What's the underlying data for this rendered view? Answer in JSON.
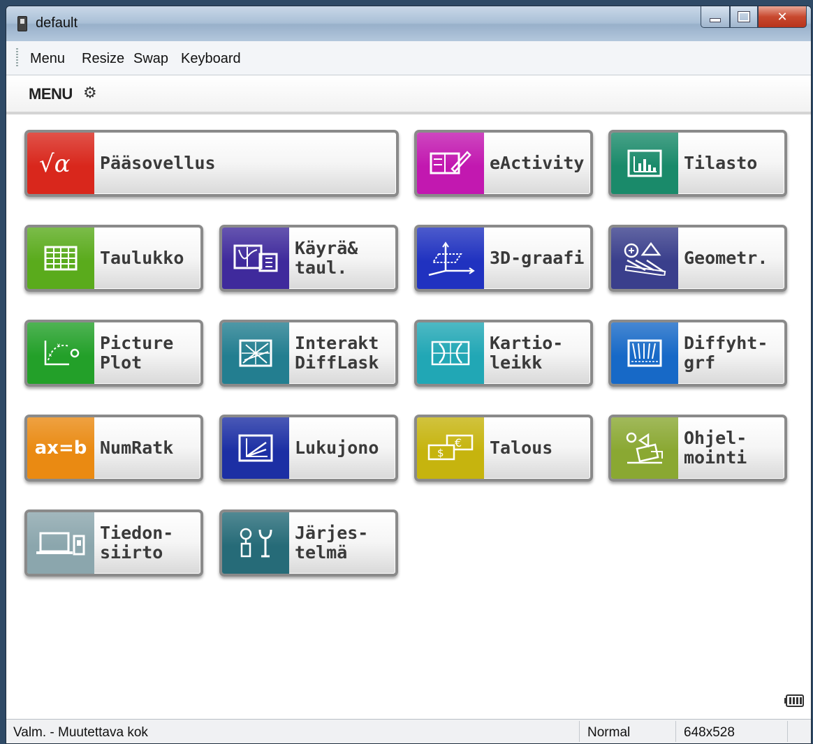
{
  "window": {
    "title": "default"
  },
  "menubar": {
    "items": [
      "Menu",
      "Resize",
      "Swap",
      "Keyboard"
    ]
  },
  "header": {
    "title": "MENU"
  },
  "tiles": [
    {
      "label1": "Pääsovellus",
      "label2": "",
      "color": "#d9271c",
      "icon": "sqrt-alpha-icon"
    },
    {
      "label1": "eActivity",
      "label2": "",
      "color": "#c218b0",
      "icon": "eactivity-icon"
    },
    {
      "label1": "Tilasto",
      "label2": "",
      "color": "#1a8a6a",
      "icon": "statistics-icon"
    },
    {
      "label1": "Taulukko",
      "label2": "",
      "color": "#5aab1c",
      "icon": "spreadsheet-icon"
    },
    {
      "label1": "Käyrä&",
      "label2": "taul.",
      "color": "#3f2a9c",
      "icon": "graph-table-icon"
    },
    {
      "label1": "3D-graafi",
      "label2": "",
      "color": "#2032c0",
      "icon": "3d-graph-icon"
    },
    {
      "label1": "Geometr.",
      "label2": "",
      "color": "#3a3f8c",
      "icon": "geometry-icon"
    },
    {
      "label1": "Picture",
      "label2": "Plot",
      "color": "#23a029",
      "icon": "picture-plot-icon"
    },
    {
      "label1": "Interakt",
      "label2": "DiffLask",
      "color": "#237e90",
      "icon": "interactive-diff-icon"
    },
    {
      "label1": "Kartio-",
      "label2": "leikk",
      "color": "#21a7b5",
      "icon": "conic-icon"
    },
    {
      "label1": "Diffyht-",
      "label2": "grf",
      "color": "#1769c7",
      "icon": "diff-equation-icon"
    },
    {
      "label1": "NumRatk",
      "label2": "",
      "color": "#ea8a12",
      "icon": "ax-equals-b-icon",
      "iconText": "ax=b"
    },
    {
      "label1": "Lukujono",
      "label2": "",
      "color": "#1c2fa4",
      "icon": "sequence-icon"
    },
    {
      "label1": "Talous",
      "label2": "",
      "color": "#c6b40e",
      "icon": "finance-icon"
    },
    {
      "label1": "Ohjel-",
      "label2": "mointi",
      "color": "#8aa832",
      "icon": "program-icon"
    },
    {
      "label1": "Tiedon-",
      "label2": "siirto",
      "color": "#8ba6ad",
      "icon": "transfer-icon"
    },
    {
      "label1": "Järjes-",
      "label2": "telmä",
      "color": "#266b78",
      "icon": "system-icon"
    }
  ],
  "status": {
    "left": "Valm. - Muutettava kok",
    "mode": "Normal",
    "size": "648x528"
  }
}
